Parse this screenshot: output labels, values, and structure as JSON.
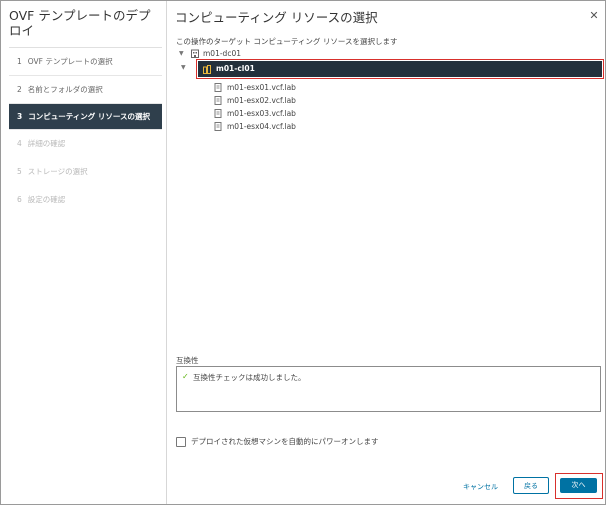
{
  "wizard": {
    "title": "OVF テンプレートのデプロイ",
    "steps": [
      {
        "num": "1",
        "label": "OVF テンプレートの選択",
        "state": "done"
      },
      {
        "num": "2",
        "label": "名前とフォルダの選択",
        "state": "done"
      },
      {
        "num": "3",
        "label": "コンピューティング リソースの選択",
        "state": "active"
      },
      {
        "num": "4",
        "label": "詳細の確認",
        "state": "disabled"
      },
      {
        "num": "5",
        "label": "ストレージの選択",
        "state": "disabled"
      },
      {
        "num": "6",
        "label": "設定の確認",
        "state": "disabled"
      }
    ]
  },
  "main": {
    "title": "コンピューティング リソースの選択",
    "instruction": "この操作のターゲット コンピューティング リソースを選択します",
    "tree": {
      "datacenter": "m01-dc01",
      "cluster": "m01-cl01",
      "hosts": [
        "m01-esx01.vcf.lab",
        "m01-esx02.vcf.lab",
        "m01-esx03.vcf.lab",
        "m01-esx04.vcf.lab"
      ]
    },
    "compatibility": {
      "label": "互換性",
      "message": "互換性チェックは成功しました。"
    },
    "power_on_label": "デプロイされた仮想マシンを自動的にパワーオンします"
  },
  "footer": {
    "cancel_label": "キャンセル",
    "back_label": "戻る",
    "next_label": "次へ"
  },
  "icons": {
    "close": "close-icon",
    "datacenter": "datacenter-icon",
    "cluster": "cluster-icon",
    "host": "host-icon",
    "check": "check-icon"
  },
  "colors": {
    "active_step_bg": "#2f3f4c",
    "selected_row_bg": "#23303b",
    "primary": "#0072a3",
    "highlight": "#d8302c",
    "success": "#60b515"
  }
}
